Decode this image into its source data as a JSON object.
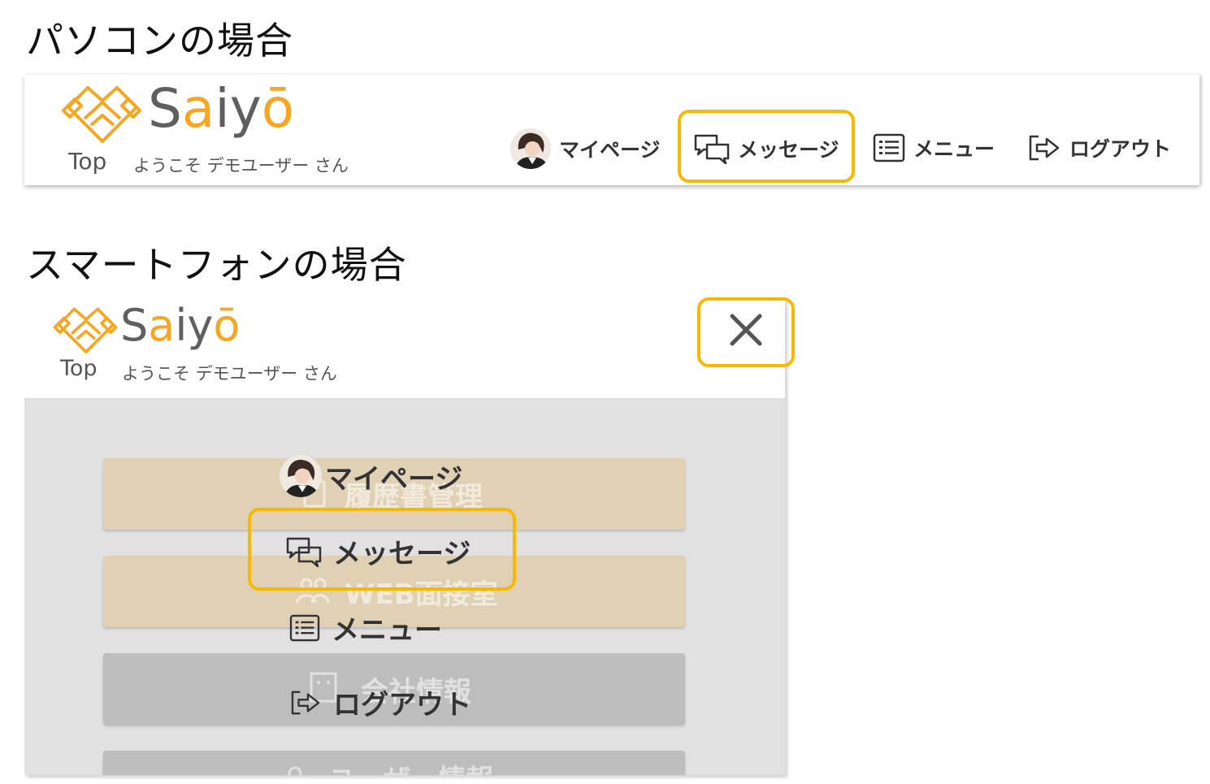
{
  "pc_section": {
    "title": "パソコンの場合"
  },
  "sp_section": {
    "title": "スマートフォンの場合"
  },
  "header": {
    "logo_text_s": "S",
    "logo_text_a": "a",
    "logo_text_iy": "iy",
    "logo_text_o": "ō",
    "top_link": "Top",
    "welcome": "ようこそ デモユーザー さん"
  },
  "nav": {
    "mypage": "マイページ",
    "message": "メッセージ",
    "menu": "メニュー",
    "logout": "ログアウト"
  },
  "sp_menu": {
    "background_items": [
      "履歴書管理",
      "WEB面接室",
      "会社情報",
      "ユーザー情報"
    ]
  },
  "colors": {
    "accent": "#f8b800",
    "logo_orange": "#f5a623",
    "logo_gray": "#5f5f5f",
    "menu_beige": "#e0d1b4",
    "menu_gray": "#bdbdbd"
  },
  "icons": [
    "handshake-logo-icon",
    "avatar-icon",
    "chat-bubbles-icon",
    "list-icon",
    "logout-arrow-icon",
    "close-icon",
    "document-icon",
    "people-icon",
    "building-icon",
    "user-icon"
  ]
}
